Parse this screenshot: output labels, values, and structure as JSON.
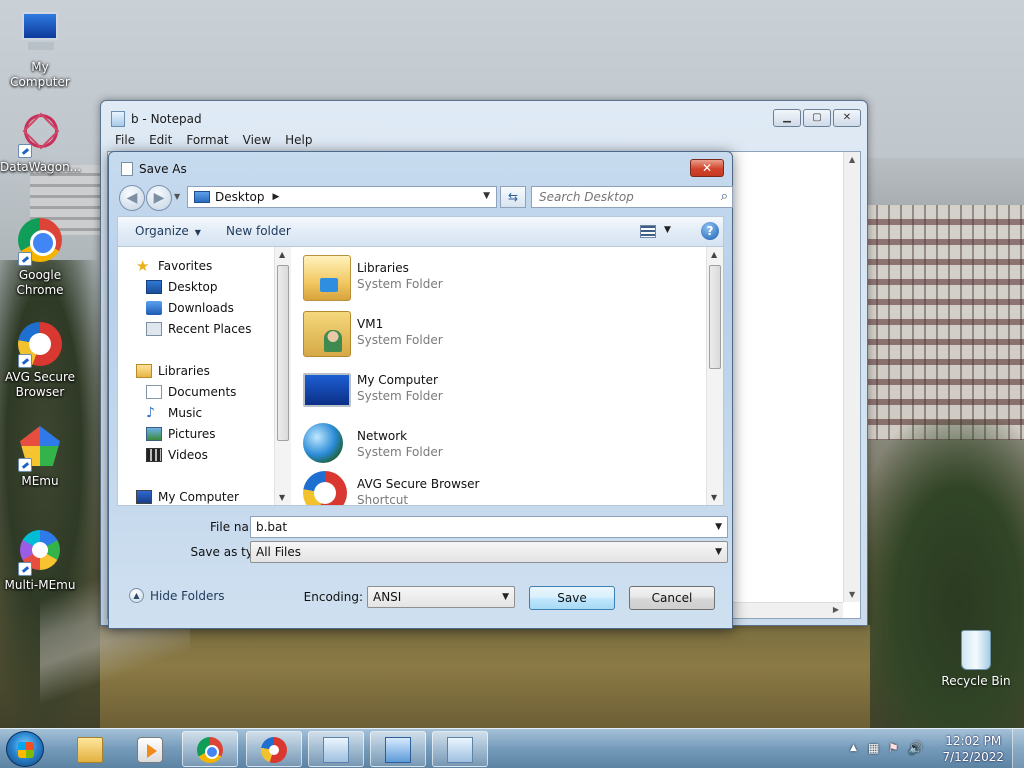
{
  "desktop": {
    "icons": [
      {
        "label": "My Computer"
      },
      {
        "label": "DataWagon..."
      },
      {
        "label": "Google Chrome"
      },
      {
        "label": "AVG Secure Browser"
      },
      {
        "label": "MEmu"
      },
      {
        "label": "Multi-MEmu"
      }
    ],
    "recycle_bin": "Recycle Bin"
  },
  "notepad": {
    "title": "b - Notepad",
    "menu": [
      "File",
      "Edit",
      "Format",
      "View",
      "Help"
    ]
  },
  "dialog": {
    "title": "Save As",
    "address": {
      "location": "Desktop"
    },
    "search": {
      "placeholder": "Search Desktop"
    },
    "toolbar": {
      "organize": "Organize",
      "new_folder": "New folder"
    },
    "nav_pane": {
      "favorites": "Favorites",
      "desktop": "Desktop",
      "downloads": "Downloads",
      "recent_places": "Recent Places",
      "libraries": "Libraries",
      "documents": "Documents",
      "music": "Music",
      "pictures": "Pictures",
      "videos": "Videos",
      "my_computer": "My Computer"
    },
    "files": [
      {
        "name": "Libraries",
        "type": "System Folder"
      },
      {
        "name": "VM1",
        "type": "System Folder"
      },
      {
        "name": "My Computer",
        "type": "System Folder"
      },
      {
        "name": "Network",
        "type": "System Folder"
      },
      {
        "name": "AVG Secure Browser",
        "type": "Shortcut"
      }
    ],
    "fields": {
      "file_name_label": "File name:",
      "file_name_value": "b.bat",
      "save_as_type_label": "Save as type:",
      "save_as_type_value": "All Files",
      "encoding_label": "Encoding:",
      "encoding_value": "ANSI"
    },
    "buttons": {
      "hide_folders": "Hide Folders",
      "save": "Save",
      "cancel": "Cancel"
    }
  },
  "taskbar": {
    "clock_time": "12:02 PM",
    "clock_date": "7/12/2022"
  }
}
